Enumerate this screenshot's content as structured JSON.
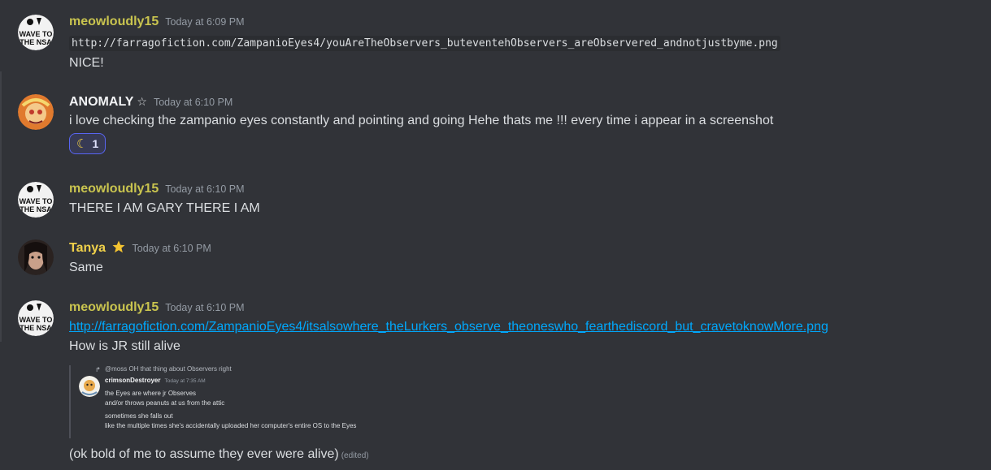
{
  "messages": [
    {
      "username": "meowloudly15",
      "timestamp": "Today at 6:09 PM",
      "code_link": "http://farragofiction.com/ZampanioEyes4/youAreTheObservers_buteventehObservers_areObservered_andnotjustbyme.png",
      "text": "NICE!",
      "avatar_text": [
        "WAVE TO",
        "THE NSA"
      ]
    },
    {
      "username": "ANOMALY",
      "badge_symbol": "☆",
      "timestamp": "Today at 6:10 PM",
      "text": "i love checking the zampanio eyes constantly and pointing and going Hehe thats me !!! every time i appear in a screenshot",
      "reaction": {
        "emoji": "☾",
        "count": "1"
      }
    },
    {
      "username": "meowloudly15",
      "timestamp": "Today at 6:10 PM",
      "text": "THERE I AM GARY THERE I AM",
      "avatar_text": [
        "WAVE TO",
        "THE NSA"
      ]
    },
    {
      "username": "Tanya",
      "timestamp": "Today at 6:10 PM",
      "text": "Same"
    },
    {
      "username": "meowloudly15",
      "timestamp": "Today at 6:10 PM",
      "link": "http://farragofiction.com/ZampanioEyes4/itsalsowhere_theLurkers_observe_theoneswho_fearthediscord_but_cravetoknowMore.png",
      "text": "How is JR still alive",
      "avatar_text": [
        "WAVE TO",
        "THE NSA"
      ],
      "embed": {
        "reply": "@moss OH that thing about Observers right",
        "name": "crimsonDestroyer",
        "timestamp": "Today at 7:35 AM",
        "lines": [
          "the Eyes are where jr Observes",
          "and/or throws peanuts at us from the attic",
          "sometimes she falls out",
          "like the multiple times she's accidentally uploaded her computer's entire OS to the Eyes"
        ]
      },
      "followup": "(ok bold of me to assume they ever were alive)",
      "edited": "(edited)"
    }
  ],
  "colors": {
    "background": "#313338",
    "username_yellow": "#c9c44f",
    "link": "#00a8fc",
    "reaction_border": "#5865f2"
  }
}
